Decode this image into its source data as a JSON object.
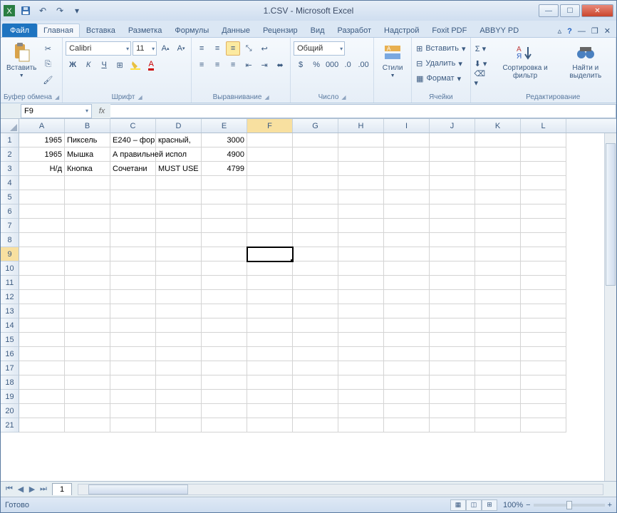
{
  "title": "1.CSV - Microsoft Excel",
  "tabs": {
    "file": "Файл",
    "items": [
      "Главная",
      "Вставка",
      "Разметка",
      "Формулы",
      "Данные",
      "Рецензир",
      "Вид",
      "Разработ",
      "Надстрой",
      "Foxit PDF",
      "ABBYY PD"
    ],
    "active": 0
  },
  "ribbon": {
    "clipboard": {
      "label": "Буфер обмена",
      "paste": "Вставить"
    },
    "font": {
      "label": "Шрифт",
      "name": "Calibri",
      "size": "11"
    },
    "align": {
      "label": "Выравнивание"
    },
    "number": {
      "label": "Число",
      "format": "Общий"
    },
    "styles": {
      "label": "",
      "btn": "Стили"
    },
    "cells": {
      "label": "Ячейки",
      "insert": "Вставить",
      "delete": "Удалить",
      "format": "Формат"
    },
    "editing": {
      "label": "Редактирование",
      "sort": "Сортировка и фильтр",
      "find": "Найти и выделить"
    }
  },
  "namebox": "F9",
  "columns": [
    "A",
    "B",
    "C",
    "D",
    "E",
    "F",
    "G",
    "H",
    "I",
    "J",
    "K",
    "L"
  ],
  "selected_col": "F",
  "selected_row": 9,
  "rows_count": 21,
  "data": [
    {
      "A": "1965",
      "B": "Пиксель",
      "C": "E240 – фор",
      "D": "красный,",
      "E": "3000"
    },
    {
      "A": "1965",
      "B": "Мышка",
      "C": "А правильней испол",
      "D": "",
      "E": "4900"
    },
    {
      "A": "Н/д",
      "B": "Кнопка",
      "C": "Сочетани",
      "D": "MUST USE",
      "E": "4799"
    }
  ],
  "sheet_tab": "1",
  "status": "Готово",
  "zoom": "100%"
}
